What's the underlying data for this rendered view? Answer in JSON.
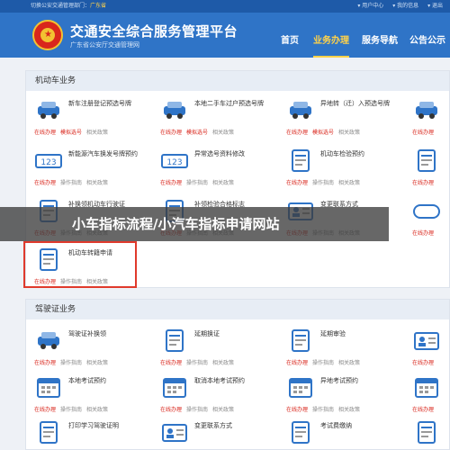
{
  "topbar": {
    "switch_label": "切换公安交通管理部门：",
    "city": "广东省",
    "user": "▾ 用户中心",
    "msg": "▾ 我的信息",
    "logout": "▾ 退出"
  },
  "header": {
    "title": "交通安全综合服务管理平台",
    "subtitle": "广东省公安厅交通管理网"
  },
  "nav": [
    "首页",
    "业务办理",
    "服务导航",
    "公告公示"
  ],
  "vehicle": {
    "title": "机动车业务",
    "tiles": [
      {
        "name": "新车注册登记预选号牌",
        "acts": [
          "在线办理",
          "模拟选号",
          "相关政策"
        ],
        "icon": "id-card-icon"
      },
      {
        "name": "本地二手车过户预选号牌",
        "acts": [
          "在线办理",
          "模拟选号",
          "相关政策"
        ],
        "icon": "car-transfer-icon"
      },
      {
        "name": "异地转（迁）入预选号牌",
        "acts": [
          "在线办理",
          "模拟选号",
          "相关政策"
        ],
        "icon": "car-move-icon"
      },
      {
        "name": "",
        "acts": [
          "在线办理"
        ],
        "icon": "car-icon"
      },
      {
        "name": "新能源汽车换发号牌预约",
        "acts": [
          "在线办理",
          "操作指南",
          "相关政策"
        ],
        "icon": "new-energy-plate-icon"
      },
      {
        "name": "异常选号资料修改",
        "acts": [
          "在线办理",
          "操作指南",
          "相关政策"
        ],
        "icon": "plate-number-icon"
      },
      {
        "name": "机动车检验预约",
        "acts": [
          "在线办理",
          "操作指南",
          "相关政策"
        ],
        "icon": "inspection-icon"
      },
      {
        "name": "",
        "acts": [
          "在线办理"
        ],
        "icon": "document-icon"
      },
      {
        "name": "补换领机动车行驶证",
        "acts": [
          "在线办理",
          "操作指南",
          "相关政策"
        ],
        "icon": "license-icon"
      },
      {
        "name": "补领检验合格标志",
        "acts": [
          "在线办理",
          "操作指南",
          "相关政策"
        ],
        "icon": "badge-icon"
      },
      {
        "name": "变更联系方式",
        "acts": [
          "在线办理",
          "操作指南",
          "相关政策"
        ],
        "icon": "contact-icon"
      },
      {
        "name": "",
        "acts": [
          "在线办理"
        ],
        "icon": "exempt-inspection-icon"
      },
      {
        "name": "机动车转籍申请",
        "acts": [
          "在线办理",
          "操作指南",
          "相关政策"
        ],
        "icon": "transfer-register-icon"
      }
    ]
  },
  "banner": "小车指标流程/小汽车指标申请网站",
  "driver": {
    "title": "驾驶证业务",
    "tiles": [
      {
        "name": "驾驶证补换领",
        "acts": [
          "在线办理",
          "操作指南",
          "相关政策"
        ],
        "icon": "driver-card-icon"
      },
      {
        "name": "延期换证",
        "acts": [
          "在线办理",
          "操作指南",
          "相关政策"
        ],
        "icon": "renew-icon"
      },
      {
        "name": "延期审验",
        "acts": [
          "在线办理",
          "操作指南",
          "相关政策"
        ],
        "icon": "review-icon"
      },
      {
        "name": "",
        "acts": [
          "在线办理"
        ],
        "icon": "person-icon"
      },
      {
        "name": "本地考试预约",
        "acts": [
          "在线办理",
          "操作指南",
          "相关政策"
        ],
        "icon": "calendar-icon"
      },
      {
        "name": "取消本地考试预约",
        "acts": [
          "在线办理",
          "操作指南",
          "相关政策"
        ],
        "icon": "calendar-cancel-icon"
      },
      {
        "name": "异地考试预约",
        "acts": [
          "在线办理",
          "操作指南",
          "相关政策"
        ],
        "icon": "calendar-remote-icon"
      },
      {
        "name": "",
        "acts": [
          "在线办理"
        ],
        "icon": "calendar-icon"
      },
      {
        "name": "打印学习驾驶证明",
        "acts": [],
        "icon": "print-icon"
      },
      {
        "name": "变更联系方式",
        "acts": [],
        "icon": "contact-icon"
      },
      {
        "name": "考试费缴纳",
        "acts": [],
        "icon": "payment-icon"
      },
      {
        "name": "",
        "acts": [],
        "icon": "document-icon"
      }
    ]
  },
  "colors": {
    "header": "#2f74c7",
    "accent": "#1e5aa8",
    "action": "#d9261c",
    "highlight": "#e03a2c"
  }
}
